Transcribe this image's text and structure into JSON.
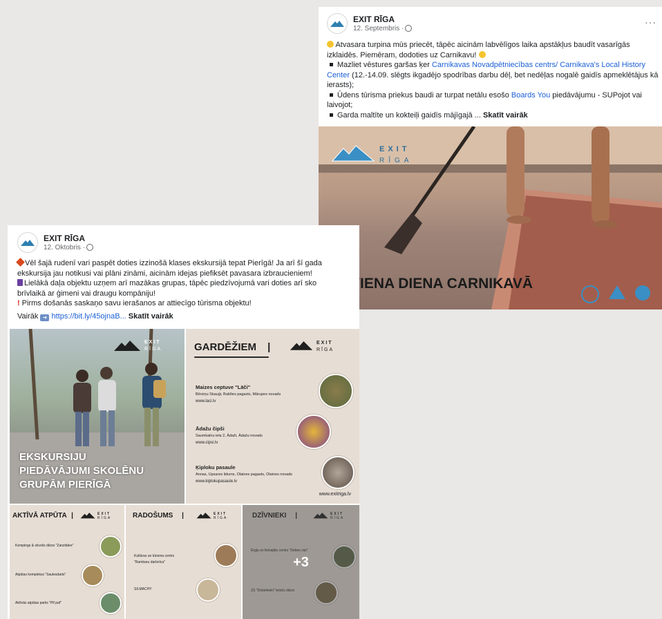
{
  "post1": {
    "page_name": "EXIT RĪGA",
    "date": "12. Septembris ·",
    "more_icon": "more-horizontal-icon",
    "line1a": "Atvasara turpina mūs priecēt, tāpēc aicinām labvēlīgos laika apstākļus baudīt vasarīgās",
    "line1b": "izklaidēs. Piemēram, dodoties uz Carnikavu!",
    "b1_pre": "Mazliet vēstures garšas ķer ",
    "b1_link1": "Carnikavas Novadpētniecības centrs/ Carnikava's Local History",
    "b1_link2": "Center",
    "b1_post1": " (12.-14.09. slēgts ikgadējo spodrības darbu dēļ, bet nedēļas nogalē gaidīs apmeklētājus kā",
    "b1_post2": "ierasts);",
    "b2_pre": "Ūdens tūrisma priekus baudi ar turpat netālu esošo ",
    "b2_link": "Boards You",
    "b2_post1": " piedāvājumu - SUPojot vai",
    "b2_post2": "laivojot;",
    "b3": "Garda maltīte un kokteiļi gaidīs mājīgajā ...",
    "see_more": "Skatīt vairāk",
    "image": {
      "logo_top": "EXIT",
      "logo_bottom": "RĪGA",
      "headline": "VIENA DIENA CARNIKAVĀ",
      "icons": [
        "hiking-icon",
        "home-icon",
        "dining-icon"
      ]
    }
  },
  "post2": {
    "page_name": "EXIT RĪGA",
    "date": "12. Oktobris ·",
    "l1": "Vēl šajā rudenī vari paspēt doties izzinošā klases ekskursijā tepat Pierīgā! Ja arī šī gada",
    "l2": "ekskursija jau notikusi vai plāni zināmi, aicinām idejas piefiksēt pavasara izbraucieniem!",
    "l3": "Lielākā daļa objektu uzņem arī mazākas grupas, tāpēc piedzīvojumā vari doties arī sko",
    "l4": "brīvlaikā ar ģimeni vai draugu kompāniju!",
    "l5": "Pirms došanās saskaņo savu ierašanos ar attiecīgo tūrisma objektu!",
    "more_label": "Vairāk",
    "link": "https://bit.ly/45ojnaB...",
    "see_more": "Skatīt vairāk",
    "tile_main": {
      "logo_top": "EXIT",
      "logo_bottom": "RĪGA",
      "line1": "EKSKURSIJU",
      "line2": "PIEDĀVĀJUMI SKOLĒNU",
      "line3": "GRUPĀM PIERĪGĀ"
    },
    "tile_food": {
      "title": "GARDĒŽIEM",
      "sep": "|",
      "logo_top": "EXIT",
      "logo_bottom": "RĪGA",
      "items": [
        {
          "name": "Maizes ceptuve \"Lāči\"",
          "addr": "Bērziņu Skauģi, Babītes pagasts, Mārupes novads",
          "url": "www.laci.lv"
        },
        {
          "name": "Ādažu čipši",
          "addr": "Saumkalnu iela 2, Ādaži, Ādažu novads",
          "url": "www.cipsi.lv"
        },
        {
          "name": "Ķiploku pasaule",
          "addr": "Annas, Upsares lidums, Olaines pagasts, Olaines novads",
          "url": "www.kiplokupasaule.lv"
        }
      ],
      "footer": "www.exitriga.lv"
    },
    "tile_active": {
      "title": "AKTĪVĀ ATPŪTA",
      "sep": "|",
      "logo_top": "EXIT",
      "logo_bottom": "RĪGA",
      "items": [
        "Kempings & skvošs dārzs \"Zanzibāre\"",
        "Atpūtas komplekss \"Saulesdarts\"",
        "Aktīvās atpūtas parks \"Pif paf\""
      ]
    },
    "tile_creative": {
      "title": "RADOŠUMS",
      "sep": "|",
      "logo_top": "EXIT",
      "logo_bottom": "RĪGA",
      "items": [
        "Kultūras un tūrisma centrs \"Rambaru darbnīca\"",
        "SILMACHY"
      ]
    },
    "tile_animals": {
      "title": "DZĪVNIEKI",
      "sep": "|",
      "logo_top": "EXIT",
      "logo_bottom": "RĪGA",
      "items": [
        "Ērgļu un lielvaijbu centrs \"Debes ziņi\"",
        "ZS \"Dobelnieki\" briežu dārzs"
      ],
      "overlay": "+3"
    }
  }
}
